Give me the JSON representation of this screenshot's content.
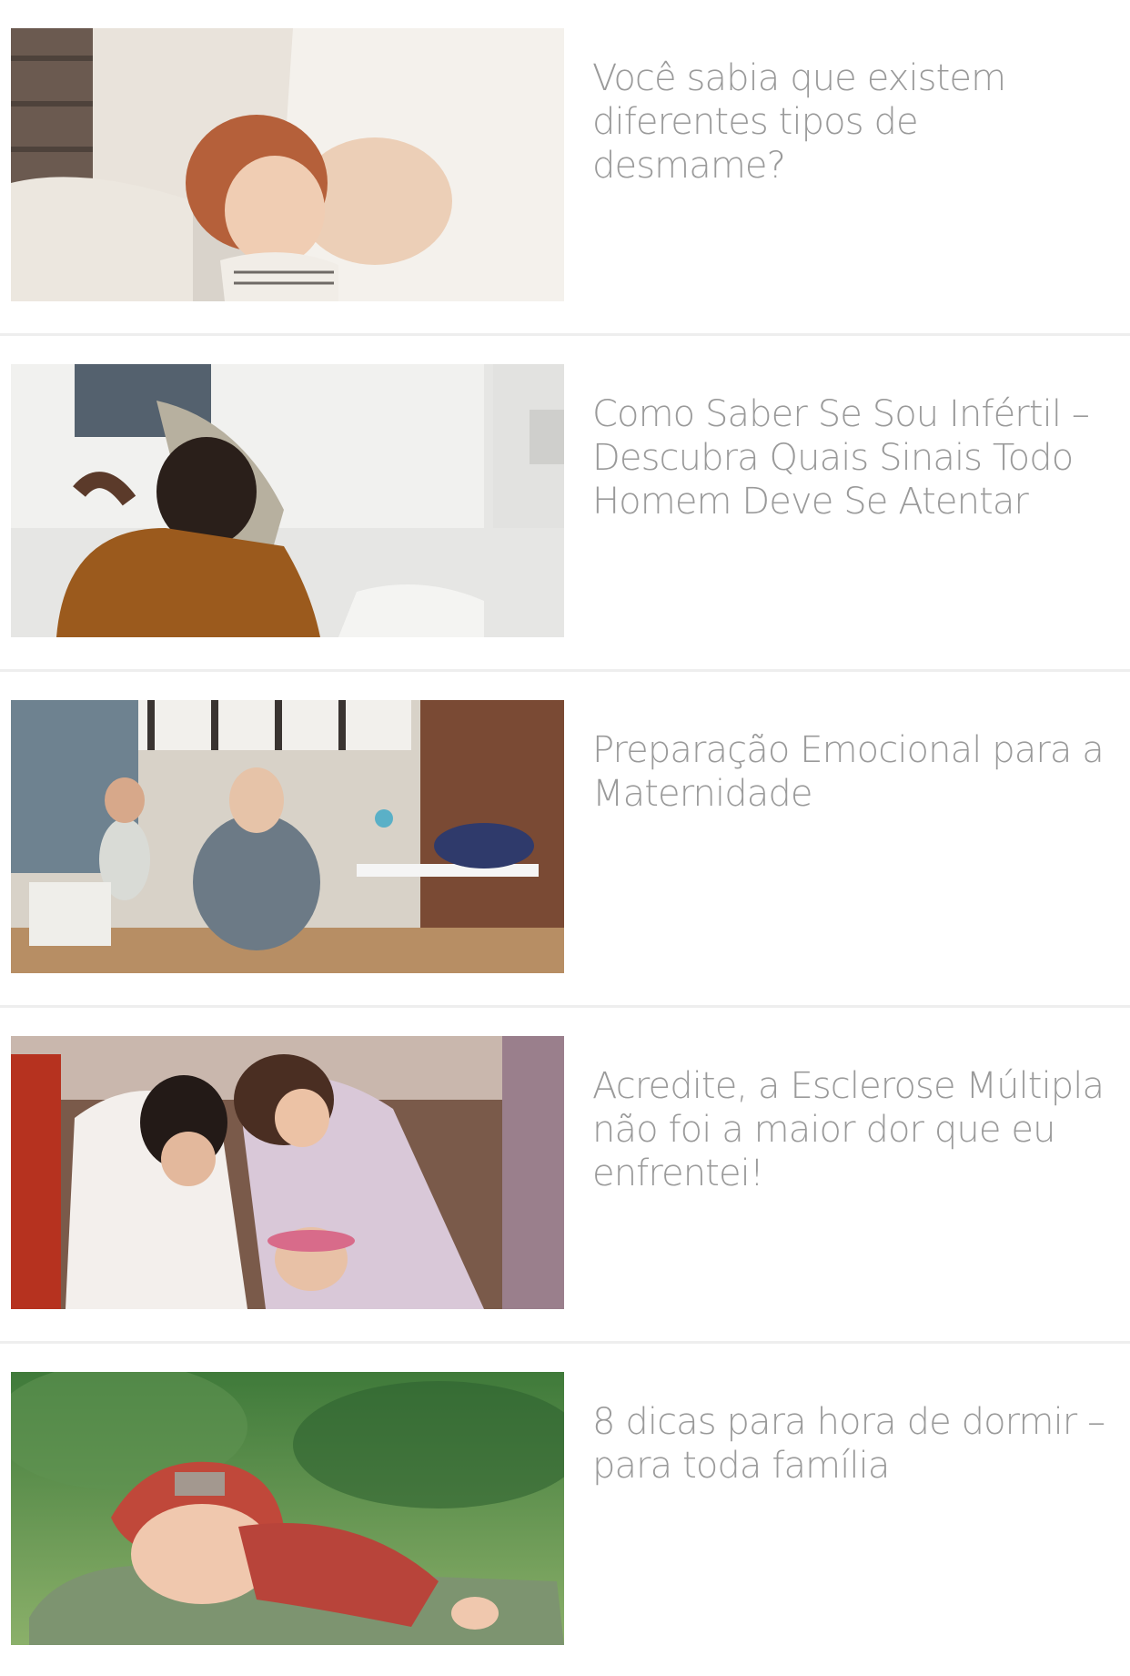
{
  "articles": [
    {
      "title": "Você sabia que existem diferentes tipos de desmame?",
      "image_icon": "mother-breastfeeding-toddler-photo"
    },
    {
      "title": "Como Saber Se Sou Infértil – Descubra Quais Sinais Todo Homem Deve Se Atentar",
      "image_icon": "worried-man-comforted-photo"
    },
    {
      "title": "Preparação Emocional para a Maternidade",
      "image_icon": "mother-baby-living-room-photo"
    },
    {
      "title": "Acredite, a Esclerose Múltipla não foi a maior dor que eu enfrentei!",
      "image_icon": "couple-with-child-ceremony-photo"
    },
    {
      "title": "8 dicas para hora de dormir – para toda família",
      "image_icon": "sleeping-newborn-red-hat-photo"
    }
  ]
}
